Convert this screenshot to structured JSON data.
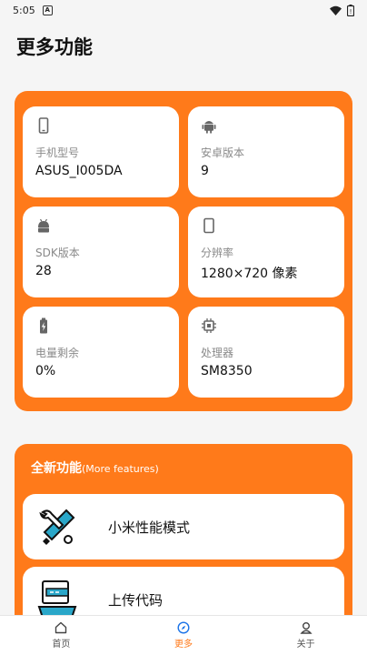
{
  "status_bar": {
    "time": "5:05"
  },
  "page": {
    "title": "更多功能"
  },
  "device_info": [
    {
      "label": "手机型号",
      "value": "ASUS_I005DA",
      "icon": "phone-icon"
    },
    {
      "label": "安卓版本",
      "value": "9",
      "icon": "android-icon"
    },
    {
      "label": "SDK版本",
      "value": "28",
      "icon": "android-head-icon"
    },
    {
      "label": "分辨率",
      "value": "1280×720 像素",
      "icon": "screen-icon"
    },
    {
      "label": "电量剩余",
      "value": "0%",
      "icon": "battery-icon"
    },
    {
      "label": "处理器",
      "value": "SM8350",
      "icon": "cpu-icon"
    }
  ],
  "features": {
    "title": "全新功能",
    "subtitle": "(More features)",
    "items": [
      {
        "label": "小米性能模式",
        "icon": "tools-icon"
      },
      {
        "label": "上传代码",
        "icon": "upload-code-icon"
      }
    ]
  },
  "nav": [
    {
      "label": "首页",
      "icon": "home-icon"
    },
    {
      "label": "更多",
      "icon": "compass-icon"
    },
    {
      "label": "关于",
      "icon": "person-icon"
    }
  ],
  "colors": {
    "accent": "#ff7a1a",
    "background": "#f5f5f5",
    "card": "#ffffff"
  }
}
